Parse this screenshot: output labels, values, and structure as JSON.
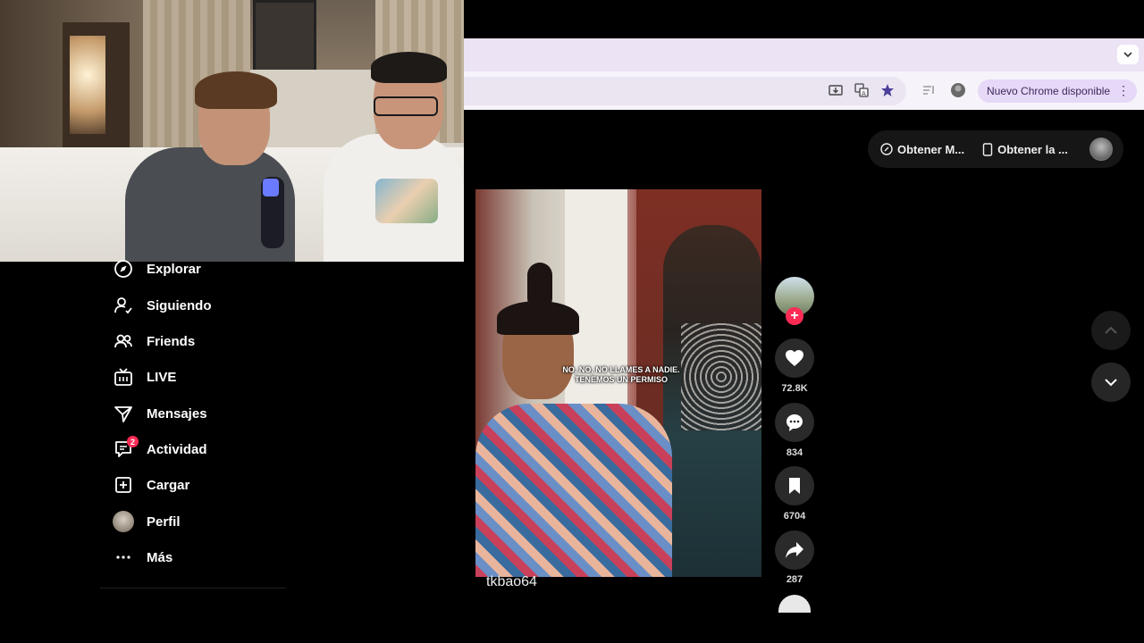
{
  "browser": {
    "update_label": "Nuevo Chrome disponible",
    "toolbar_icons": [
      "install-icon",
      "translate-icon",
      "star-icon",
      "reading-list-icon",
      "profile-icon"
    ]
  },
  "header": {
    "get_app_label": "Obtener M...",
    "get_device_label": "Obtener la ..."
  },
  "sidebar": {
    "items": [
      {
        "label": "Explorar",
        "icon": "compass-icon"
      },
      {
        "label": "Siguiendo",
        "icon": "person-follow-icon"
      },
      {
        "label": "Friends",
        "icon": "friends-icon"
      },
      {
        "label": "LIVE",
        "icon": "live-tv-icon"
      },
      {
        "label": "Mensajes",
        "icon": "paper-plane-icon"
      },
      {
        "label": "Actividad",
        "icon": "activity-icon",
        "badge": "2"
      },
      {
        "label": "Cargar",
        "icon": "plus-square-icon"
      },
      {
        "label": "Perfil",
        "icon": "avatar"
      },
      {
        "label": "Más",
        "icon": "ellipsis-icon"
      }
    ]
  },
  "video": {
    "subtitle_line1": "NO, NO, NO LLAMES A NADIE.",
    "subtitle_line2": "TENEMOS UN PERMISO",
    "username": "tkbao64"
  },
  "actions": {
    "follow_symbol": "+",
    "likes": "72.8K",
    "comments": "834",
    "saves": "6704",
    "shares": "287"
  },
  "colors": {
    "accent": "#fe2c55",
    "update_pill": "#e6d9f7"
  }
}
